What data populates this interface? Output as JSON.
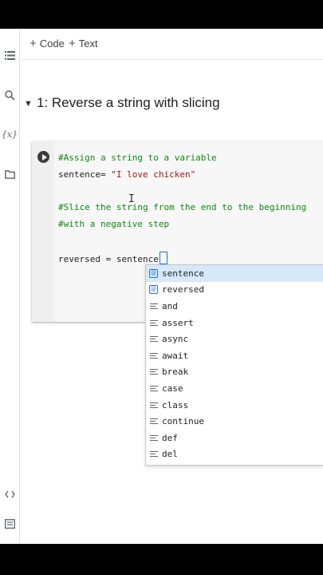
{
  "toolbar": {
    "code_label": "Code",
    "text_label": "Text"
  },
  "section": {
    "title": "1: Reverse a string with slicing"
  },
  "icons": {
    "toc": "list-icon",
    "search": "search-icon",
    "variables": "variables-icon",
    "files": "folder-icon",
    "snippets": "code-brackets-icon",
    "terminal": "terminal-icon",
    "variables_glyph": "{x}"
  },
  "cell": {
    "lines": [
      "#Assign a string to a variable",
      "sentence= ",
      "\"I love chicken\"",
      "#Slice the string from the end to the beginning",
      "#with a negative step",
      "reversed = sentence"
    ]
  },
  "autocomplete": {
    "items": [
      {
        "label": "sentence",
        "kind": "variable"
      },
      {
        "label": "reversed",
        "kind": "variable"
      },
      {
        "label": "and",
        "kind": "keyword"
      },
      {
        "label": "assert",
        "kind": "keyword"
      },
      {
        "label": "async",
        "kind": "keyword"
      },
      {
        "label": "await",
        "kind": "keyword"
      },
      {
        "label": "break",
        "kind": "keyword"
      },
      {
        "label": "case",
        "kind": "keyword"
      },
      {
        "label": "class",
        "kind": "keyword"
      },
      {
        "label": "continue",
        "kind": "keyword"
      },
      {
        "label": "def",
        "kind": "keyword"
      },
      {
        "label": "del",
        "kind": "keyword"
      }
    ]
  },
  "colors": {
    "comment": "#0d8a0d",
    "string": "#a31515",
    "selection": "#d6e8fa",
    "accent": "#1a73e8"
  }
}
